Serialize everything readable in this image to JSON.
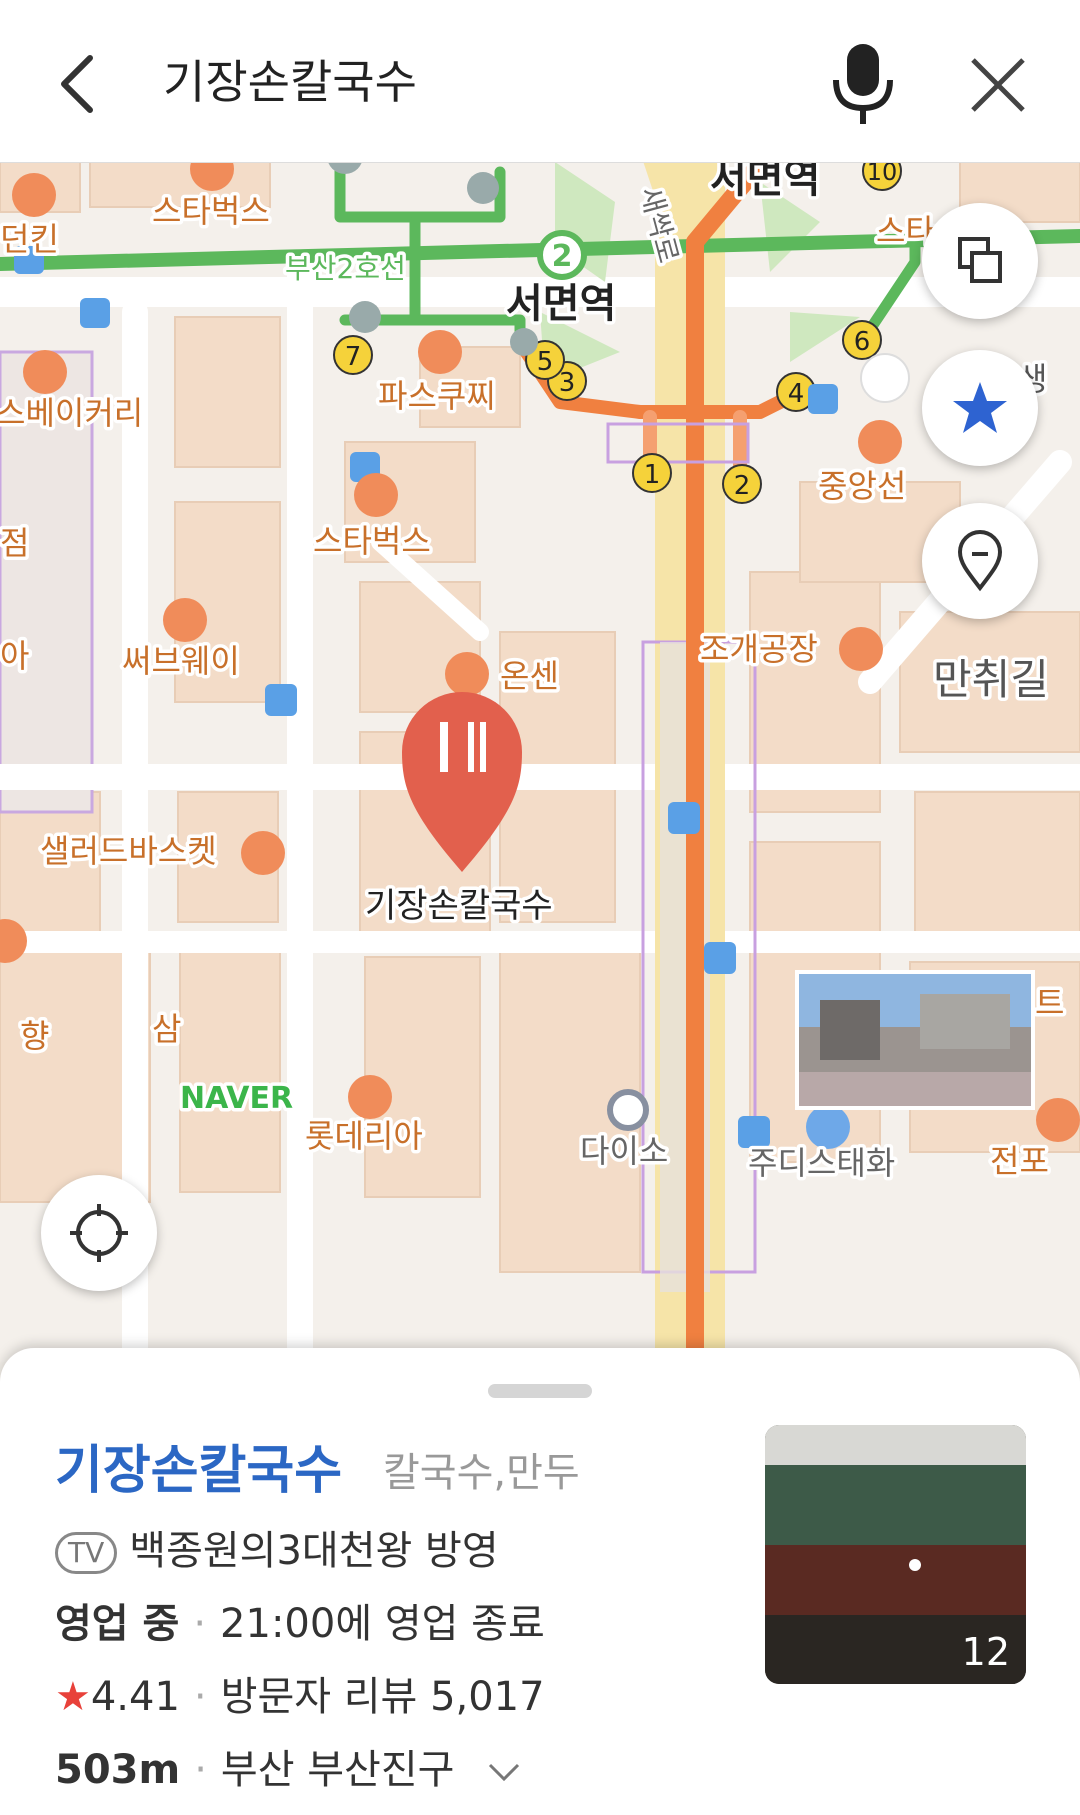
{
  "search": {
    "query": "기장손칼국수"
  },
  "map": {
    "watermark": "NAVER",
    "colors": {
      "subway_line2": "#5cb85c",
      "subway_line1": "#f08040",
      "exit_badge": "#f5d23a",
      "poi": "#f08c5a",
      "selected_pin": "#e2604d"
    },
    "labels": {
      "seomyeon_station": "서면역",
      "line_name": "부산2호선",
      "line_number": "2",
      "road_name": "새싹로",
      "street_name": "만취길",
      "dunkin": "던킨",
      "starbucks1": "스타벅스",
      "starbucks2": "스타벅스",
      "starbucks3": "스타",
      "bakery": "스베이커리",
      "pascucci": "파스쿠찌",
      "jungang": "중앙선",
      "subway_shop": "써브웨이",
      "onsen": "온센",
      "clam": "조개공장",
      "salad": "샐러드바스켓",
      "lotteria": "롯데리아",
      "daiso": "다이소",
      "jeom": "점",
      "a": "아",
      "hyang": "향",
      "sam": "삼",
      "te": "트",
      "jeonpo": "전포",
      "jongdasi": "주디스태화",
      "saeng": "생",
      "selected_place": "기장손칼국수"
    },
    "exits": [
      "1",
      "2",
      "3",
      "4",
      "5",
      "6",
      "7",
      "10"
    ]
  },
  "place": {
    "name": "기장손칼국수",
    "category": "칼국수,만두",
    "tv_badge": "TV",
    "tv_text": "백종원의3대천왕 방영",
    "status": "영업 중",
    "hours": "21:00에 영업 종료",
    "rating": "4.41",
    "reviews": "방문자 리뷰 5,017",
    "distance": "503m",
    "address": "부산 부산진구",
    "photo_count": "12"
  }
}
